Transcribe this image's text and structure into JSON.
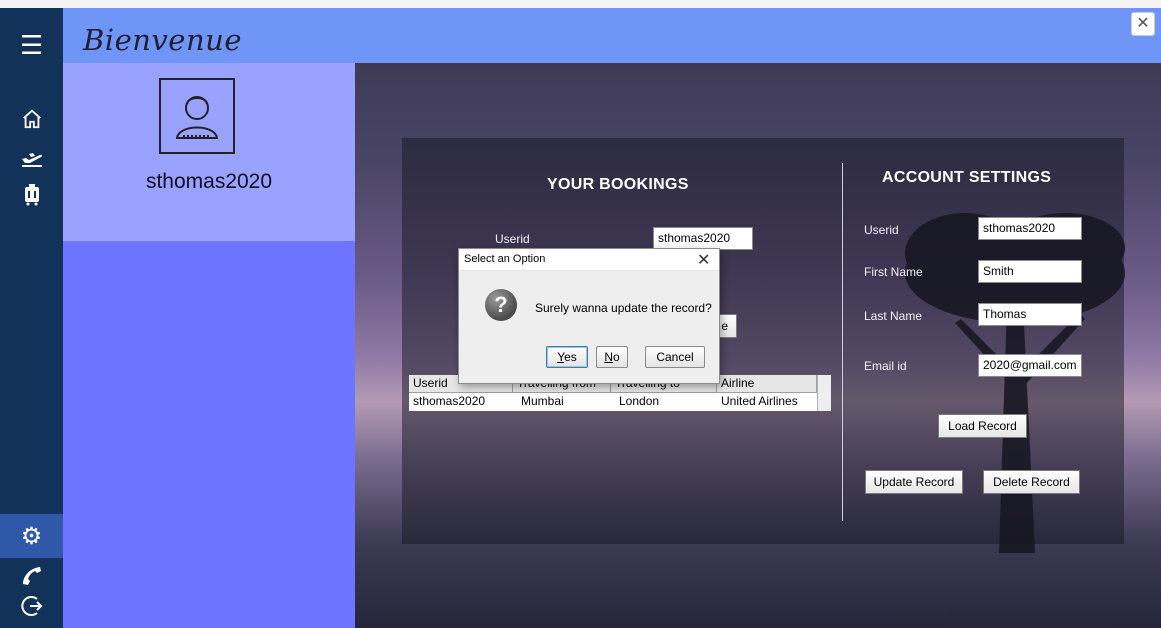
{
  "window": {
    "brand": "Bienvenue",
    "close_glyph": "✕"
  },
  "rail": {
    "icons": [
      "menu-icon",
      "home-icon",
      "flight-icon",
      "luggage-icon",
      "gear-icon",
      "phone-icon",
      "logout-icon"
    ]
  },
  "profile": {
    "username": "sthomas2020",
    "avatar_icon": "user-avatar-icon"
  },
  "bookings": {
    "title": "YOUR BOOKINGS",
    "userid_label": "Userid",
    "userid_value": "sthomas2020",
    "hidden_button_fragment": "e",
    "table": {
      "columns": [
        "Userid",
        "Travelling from",
        "Travelling to",
        "Airline"
      ],
      "rows": [
        [
          "sthomas2020",
          "Mumbai",
          "London",
          "United Airlines"
        ]
      ]
    }
  },
  "account": {
    "title": "ACCOUNT SETTINGS",
    "userid_label": "Userid",
    "userid_value": "sthomas2020",
    "first_name_label": "First Name",
    "first_name_value": "Smith",
    "last_name_label": "Last Name",
    "last_name_value": "Thomas",
    "email_label": "Email id",
    "email_value": "2020@gmail.com",
    "load_label": "Load Record",
    "update_label": "Update Record",
    "delete_label": "Delete Record"
  },
  "dialog": {
    "title": "Select an Option",
    "message": "Surely wanna update the record?",
    "yes_first": "Y",
    "yes_rest": "es",
    "no_first": "N",
    "no_rest": "o",
    "cancel_label": "Cancel",
    "icon": "question-icon"
  },
  "colors": {
    "header": "#6f96f7",
    "rail": "#13325a",
    "profile_panel": "#9aa2ff",
    "side_panel": "#6d74ff"
  }
}
